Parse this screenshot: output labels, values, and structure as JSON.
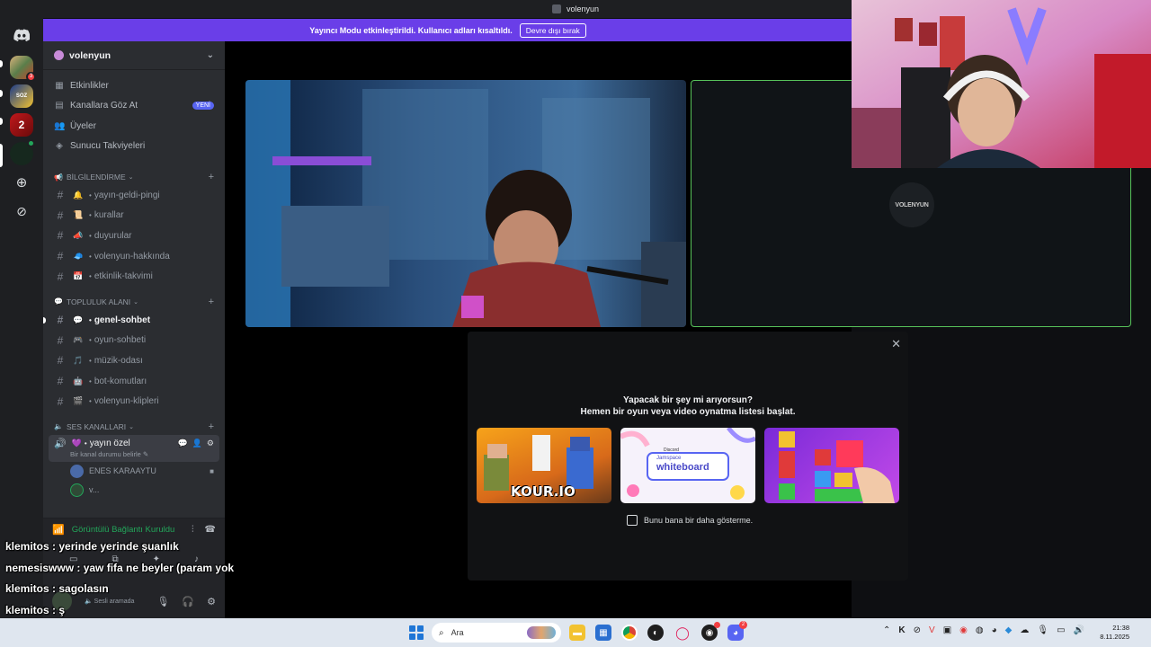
{
  "window": {
    "title": "volenyun"
  },
  "banner": {
    "message": "Yayıncı Modu etkinleştirildi. Kullanıcı adları kısaltıldı.",
    "button": "Devre dışı bırak"
  },
  "server": {
    "name": "volenyun"
  },
  "menu": {
    "events": "Etkinlikler",
    "browse": "Kanallara Göz At",
    "browse_badge": "YENİ",
    "members": "Üyeler",
    "boosts": "Sunucu Takviyeleri"
  },
  "categories": {
    "info": "BİLGİLENDİRME",
    "community": "TOPLULUK ALANI",
    "voice": "SES KANALLARI"
  },
  "info_channels": [
    {
      "emoji": "🔔",
      "name": "yayın-geldi-pingi"
    },
    {
      "emoji": "📜",
      "name": "kurallar"
    },
    {
      "emoji": "📣",
      "name": "duyurular"
    },
    {
      "emoji": "🧢",
      "name": "volenyun-hakkında"
    },
    {
      "emoji": "📅",
      "name": "etkinlik-takvimi"
    }
  ],
  "community_channels": [
    {
      "emoji": "💬",
      "name": "genel-sohbet"
    },
    {
      "emoji": "🎮",
      "name": "oyun-sohbeti"
    },
    {
      "emoji": "🎵",
      "name": "müzik-odası"
    },
    {
      "emoji": "🤖",
      "name": "bot-komutları"
    },
    {
      "emoji": "🎬",
      "name": "volenyun-klipleri"
    }
  ],
  "voice_channel": {
    "name": "yayın özel",
    "status_placeholder": "Bir kanal durumu belirle"
  },
  "voice_members": [
    {
      "name": "ENES KARAAYTU"
    },
    {
      "name": "v..."
    }
  ],
  "connection": {
    "status": "Görüntülü Bağlantı Kuruldu",
    "user_status": "Sesli aramada"
  },
  "stream_tile": {
    "avatar_text": "VOLENYUN"
  },
  "activity_modal": {
    "title_line1": "Yapacak bir şey mi arıyorsun?",
    "title_line2": "Hemen bir oyun veya video oynatma listesi başlat.",
    "cards": [
      {
        "name": "KOUR.IO"
      },
      {
        "name": "whiteboard",
        "brand": "Discord",
        "prefix": "Jamspace"
      },
      {
        "name": "Tetris-like puzzle"
      }
    ],
    "dont_show": "Bunu bana bir daha gösterme."
  },
  "chat": [
    {
      "user": "klemitos",
      "text": "yerinde yerinde şuanlık"
    },
    {
      "user": "nemesiswww",
      "text": "yaw fifa ne beyler (param yok"
    },
    {
      "user": "klemitos",
      "text": "sagolasın"
    },
    {
      "user": "klemitos",
      "text": "ş"
    }
  ],
  "taskbar": {
    "search_placeholder": "Ara",
    "time": "21:38",
    "date": "8.11.2025",
    "discord_badge": "2"
  },
  "colors": {
    "accent": "#5865f2",
    "banner": "#6a3ee8",
    "online": "#23a55a",
    "tile_border": "#57c25a"
  }
}
